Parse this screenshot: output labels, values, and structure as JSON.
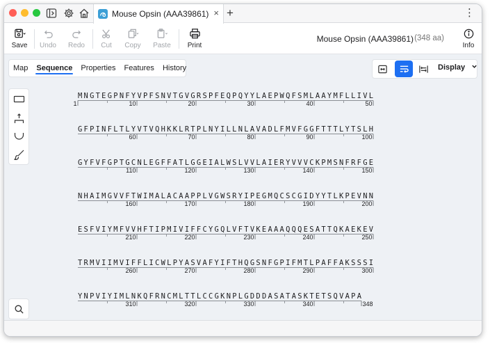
{
  "titlebar": {
    "tab_title": "Mouse Opsin (AAA39861)",
    "close_glyph": "×",
    "new_tab_glyph": "+",
    "menu_glyph": "⋮"
  },
  "toolbar": {
    "save": "Save",
    "undo": "Undo",
    "redo": "Redo",
    "cut": "Cut",
    "copy": "Copy",
    "paste": "Paste",
    "print": "Print",
    "info": "Info",
    "sequence_name": "Mouse Opsin (AAA39861)",
    "sequence_length": "(348 aa)"
  },
  "view_tabs": [
    {
      "label": "Map",
      "active": false
    },
    {
      "label": "Sequence",
      "active": true
    },
    {
      "label": "Properties",
      "active": false
    },
    {
      "label": "Features",
      "active": false
    },
    {
      "label": "History",
      "active": false
    }
  ],
  "display_menu": {
    "label": "Display"
  },
  "colors": {
    "accent": "#1d6ff2",
    "background": "#eef1f5",
    "text": "#1d1d1f"
  },
  "sequence": {
    "residues_per_line": 50,
    "total_length": 348,
    "lines": [
      {
        "start": 1,
        "residues": "MNGTEGPNFYVPFSNVTGVGRSPFEQPQYYLAEPWQFSMLAAYMFLLIVL"
      },
      {
        "start": 51,
        "residues": "GFPINFLTLYVTVQHKKLRTPLNYILLNLAVADLFMVFGGFTTTLYTSLH"
      },
      {
        "start": 101,
        "residues": "GYFVFGPTGCNLEGFFATLGGEIALWSLVVLAIERYVVVCKPMSNFRFGE"
      },
      {
        "start": 151,
        "residues": "NHAIMGVVFTWIMALACAAPPLVGWSRYIPEGMQCSCGIDYYTLKPEVNN"
      },
      {
        "start": 201,
        "residues": "ESFVIYMFVVHFTIPMIVIFFCYGQLVFTVKEAAAQQQESATTQKAEKEV"
      },
      {
        "start": 251,
        "residues": "TRMVIIMVIFFLICWLPYASVAFYIFTHQGSNFGPIFMTLPAFFAKSSSI"
      },
      {
        "start": 301,
        "residues": "YNPVIYIMLNKQFRNCMLTTLCCGKNPLGDDDASATASKTETSQVAPA"
      }
    ]
  }
}
